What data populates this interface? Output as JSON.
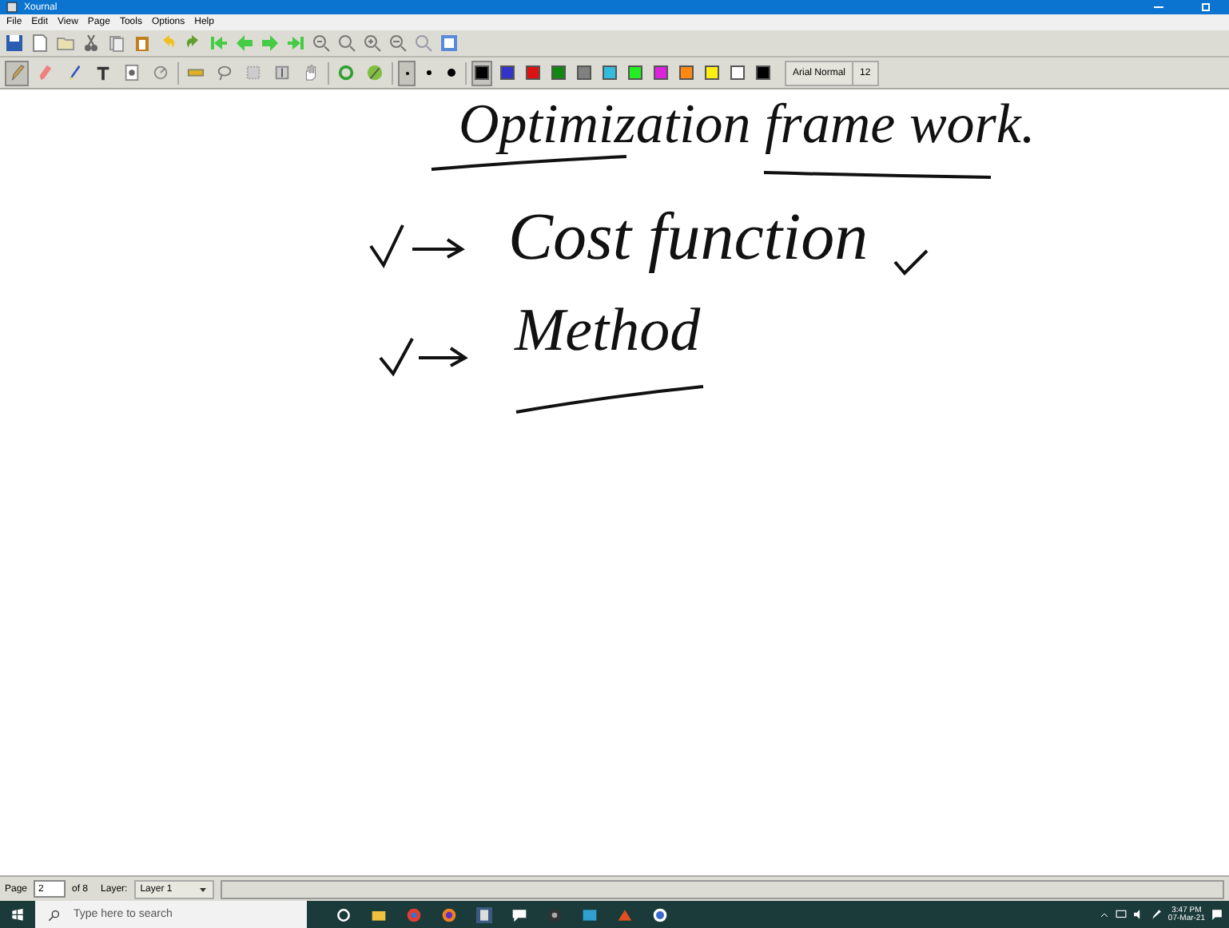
{
  "window": {
    "title": "Xournal"
  },
  "menu": [
    "File",
    "Edit",
    "View",
    "Page",
    "Tools",
    "Options",
    "Help"
  ],
  "tools": [
    {
      "selected": true
    },
    {
      "selected": false
    },
    {
      "selected": false
    },
    {
      "selected": false
    },
    {
      "selected": false
    },
    {
      "selected": false
    },
    {
      "selected": false
    },
    {
      "selected": false
    },
    {
      "selected": false
    },
    {
      "selected": false
    },
    {
      "selected": false
    },
    {
      "selected": false
    },
    {
      "selected": false
    }
  ],
  "pen_sizes": [
    {
      "selected": true
    },
    {
      "selected": false
    },
    {
      "selected": false
    }
  ],
  "colors": [
    {
      "color": "#000000",
      "selected": true
    },
    {
      "color": "#3333cc",
      "selected": false
    },
    {
      "color": "#dd1111",
      "selected": false
    },
    {
      "color": "#118811",
      "selected": false
    },
    {
      "color": "#808080",
      "selected": false
    },
    {
      "color": "#33bbdd",
      "selected": false
    },
    {
      "color": "#22ee22",
      "selected": false
    },
    {
      "color": "#dd22dd",
      "selected": false
    },
    {
      "color": "#ff8811",
      "selected": false
    },
    {
      "color": "#ffee11",
      "selected": false
    },
    {
      "color": "#ffffff",
      "selected": false
    },
    {
      "color": "#000000",
      "selected": false
    }
  ],
  "font": {
    "name": "Arial Normal",
    "size": "12"
  },
  "notes": [
    {
      "kind": "title",
      "text": "Optimization frame work."
    },
    {
      "kind": "item",
      "text": "Cost function"
    },
    {
      "kind": "item",
      "text": "Method"
    }
  ],
  "status_bar": {
    "page_label": "Page",
    "page": "2",
    "page_total": "of 8",
    "layer_label": "Layer:",
    "layer": "Layer 1"
  },
  "taskbar": {
    "search_placeholder": "Type here to search",
    "time": "3:47 PM",
    "date": "07-Mar-21"
  }
}
